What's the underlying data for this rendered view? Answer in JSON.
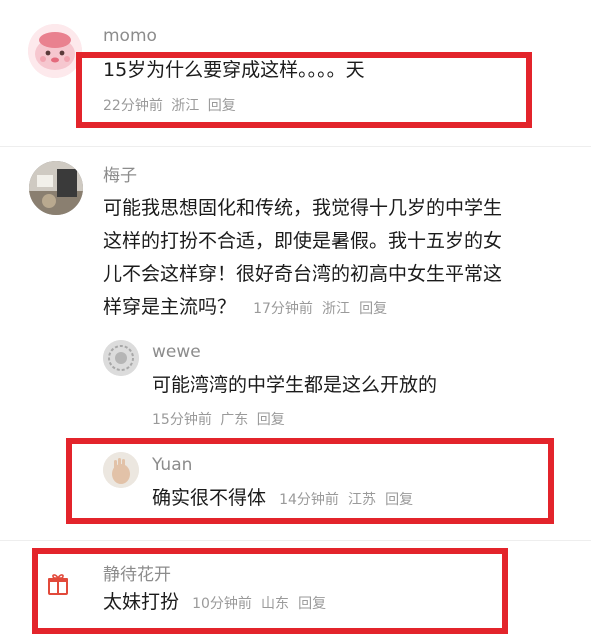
{
  "comments": [
    {
      "user": "momo",
      "text": "15岁为什么要穿成这样。。。。天",
      "time": "22分钟前",
      "location": "浙江",
      "reply_label": "回复",
      "avatar_icon": "pink-cartoon-face-icon"
    },
    {
      "user": "梅子",
      "text_lines": [
        "可能我思想固化和传统，我觉得十几岁的中学生",
        "这样的打扮不合适，即使是暑假。我十五岁的女",
        "儿不会这样穿！很好奇台湾的初高中女生平常这",
        "样穿是主流吗？"
      ],
      "time": "17分钟前",
      "location": "浙江",
      "reply_label": "回复",
      "avatar_icon": "photo-avatar-icon",
      "replies": [
        {
          "user": "wewe",
          "text": "可能湾湾的中学生都是这么开放的",
          "time": "15分钟前",
          "location": "广东",
          "reply_label": "回复",
          "avatar_icon": "gray-pattern-avatar-icon"
        },
        {
          "user": "Yuan",
          "text": "确实很不得体",
          "time": "14分钟前",
          "location": "江苏",
          "reply_label": "回复",
          "avatar_icon": "hand-avatar-icon"
        }
      ]
    },
    {
      "user": "静待花开",
      "text": "太妹打扮",
      "time": "10分钟前",
      "location": "山东",
      "reply_label": "回复",
      "avatar_icon": "gift-icon"
    }
  ],
  "colors": {
    "highlight": "#e3242b",
    "username": "#8c8c8c",
    "meta": "#9a9a9a"
  }
}
